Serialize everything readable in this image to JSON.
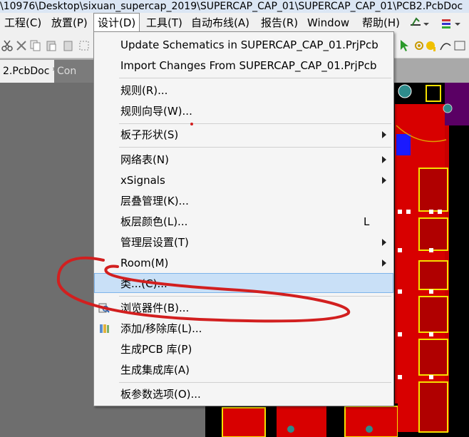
{
  "window": {
    "title": "\\10976\\Desktop\\sixuan_supercap_2019\\SUPERCAP_CAP_01\\SUPERCAP_CAP_01\\PCB2.PcbDoc"
  },
  "menubar": {
    "items": [
      {
        "label": "工程(C)"
      },
      {
        "label": "放置(P)"
      },
      {
        "label": "设计(D)"
      },
      {
        "label": "工具(T)"
      },
      {
        "label": "自动布线(A)"
      },
      {
        "label": "报告(R)"
      },
      {
        "label": "Window"
      },
      {
        "label": "帮助(H)"
      }
    ]
  },
  "tabs": [
    {
      "label": "2.PcbDoc *"
    },
    {
      "label": "Con"
    }
  ],
  "design_menu": {
    "items": [
      {
        "label": "Update Schematics in SUPERCAP_CAP_01.PrjPcb"
      },
      {
        "label": "Import Changes From SUPERCAP_CAP_01.PrjPcb"
      },
      {
        "label": "规则(R)..."
      },
      {
        "label": "规则向导(W)..."
      },
      {
        "label": "板子形状(S)"
      },
      {
        "label": "网络表(N)"
      },
      {
        "label": "xSignals"
      },
      {
        "label": "层叠管理(K)..."
      },
      {
        "label": "板层颜色(L)...",
        "shortcut": "L"
      },
      {
        "label": "管理层设置(T)"
      },
      {
        "label": "Room(M)"
      },
      {
        "label": "类...(C)..."
      },
      {
        "label": "浏览器件(B)..."
      },
      {
        "label": "添加/移除库(L)..."
      },
      {
        "label": "生成PCB 库(P)"
      },
      {
        "label": "生成集成库(A)"
      },
      {
        "label": "板参数选项(O)..."
      }
    ]
  },
  "colors": {
    "highlight": "#c9e0f7",
    "pcb_copper": "#e00000",
    "annotation": "#d21f1f"
  },
  "icons": [
    "scissors-icon",
    "copy-icon",
    "paste-icon",
    "cursor-icon",
    "pin-icon",
    "browse-components-icon",
    "library-icon"
  ]
}
